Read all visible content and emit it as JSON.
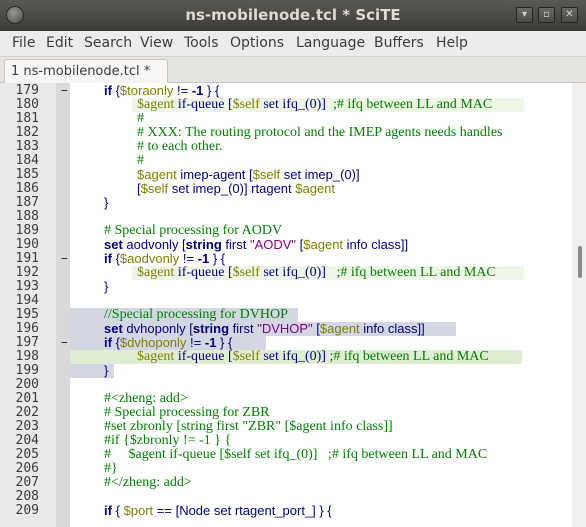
{
  "window": {
    "title": "ns-mobilenode.tcl * SciTE"
  },
  "window_buttons": {
    "minimize": "▾",
    "maximize": "▫",
    "close": "✕"
  },
  "menu": [
    "File",
    "Edit",
    "Search",
    "View",
    "Tools",
    "Options",
    "Language",
    "Buffers",
    "Help"
  ],
  "tab": {
    "label": "1 ns-mobilenode.tcl *"
  },
  "lines": [
    {
      "n": "179",
      "fold": "−",
      "hl": "",
      "tokens": [
        [
          "kw",
          "if"
        ],
        [
          "plain",
          " {"
        ],
        [
          "var",
          "$toraonly"
        ],
        [
          "plain",
          " != "
        ],
        [
          "kw",
          "-1"
        ],
        [
          "plain",
          " } {"
        ]
      ]
    },
    {
      "n": "180",
      "fold": "",
      "hl": "pale",
      "tokens": [
        [
          "var",
          "$agent"
        ],
        [
          "txt",
          " if-queue ["
        ],
        [
          "var",
          "$self"
        ],
        [
          "txt",
          " set ifq_(0)]  "
        ],
        [
          "cmt",
          ";# ifq between LL and MAC"
        ]
      ]
    },
    {
      "n": "181",
      "fold": "",
      "hl": "",
      "tokens": [
        [
          "cmt",
          "#"
        ]
      ]
    },
    {
      "n": "182",
      "fold": "",
      "hl": "",
      "tokens": [
        [
          "cmt",
          "# XXX: The routing protocol and the IMEP agents needs handles"
        ]
      ]
    },
    {
      "n": "183",
      "fold": "",
      "hl": "",
      "tokens": [
        [
          "cmt",
          "# to each other."
        ]
      ]
    },
    {
      "n": "184",
      "fold": "",
      "hl": "",
      "tokens": [
        [
          "cmt",
          "#"
        ]
      ]
    },
    {
      "n": "185",
      "fold": "",
      "hl": "",
      "tokens": [
        [
          "var",
          "$agent"
        ],
        [
          "txt",
          " imep-agent ["
        ],
        [
          "var",
          "$self"
        ],
        [
          "txt",
          " set imep_(0)]"
        ]
      ]
    },
    {
      "n": "186",
      "fold": "",
      "hl": "",
      "tokens": [
        [
          "txt",
          "["
        ],
        [
          "var",
          "$self"
        ],
        [
          "txt",
          " set imep_(0)] rtagent "
        ],
        [
          "var",
          "$agent"
        ]
      ]
    },
    {
      "n": "187",
      "fold": "",
      "hl": "",
      "tokens": [
        [
          "plain",
          "}"
        ]
      ]
    },
    {
      "n": "188",
      "fold": "",
      "hl": "",
      "tokens": []
    },
    {
      "n": "189",
      "fold": "",
      "hl": "",
      "tokens": [
        [
          "cmt",
          "# Special processing for AODV"
        ]
      ]
    },
    {
      "n": "190",
      "fold": "",
      "hl": "",
      "tokens": [
        [
          "kw",
          "set"
        ],
        [
          "txt",
          " aodvonly ["
        ],
        [
          "kw",
          "string"
        ],
        [
          "txt",
          " first "
        ],
        [
          "str",
          "\"AODV\""
        ],
        [
          "txt",
          " ["
        ],
        [
          "var",
          "$agent"
        ],
        [
          "txt",
          " info class]]"
        ]
      ]
    },
    {
      "n": "191",
      "fold": "−",
      "hl": "",
      "tokens": [
        [
          "kw",
          "if"
        ],
        [
          "plain",
          " {"
        ],
        [
          "var",
          "$aodvonly"
        ],
        [
          "plain",
          " != "
        ],
        [
          "kw",
          "-1"
        ],
        [
          "plain",
          " } {"
        ]
      ]
    },
    {
      "n": "192",
      "fold": "",
      "hl": "pale",
      "tokens": [
        [
          "var",
          "$agent"
        ],
        [
          "txt",
          " if-queue ["
        ],
        [
          "var",
          "$self"
        ],
        [
          "txt",
          " set ifq_(0)]   "
        ],
        [
          "cmt",
          ";# ifq between LL and MAC"
        ]
      ]
    },
    {
      "n": "193",
      "fold": "",
      "hl": "",
      "tokens": [
        [
          "plain",
          "}"
        ]
      ]
    },
    {
      "n": "194",
      "fold": "",
      "hl": "",
      "tokens": []
    },
    {
      "n": "195",
      "fold": "",
      "hl": "sel",
      "tokens": [
        [
          "cmt",
          "//Special processing for DVHOP"
        ]
      ]
    },
    {
      "n": "196",
      "fold": "",
      "hl": "sel",
      "tokens": [
        [
          "kw",
          "set"
        ],
        [
          "txt",
          " dvhoponly ["
        ],
        [
          "kw",
          "string"
        ],
        [
          "txt",
          " first "
        ],
        [
          "str",
          "\"DVHOP\""
        ],
        [
          "txt",
          " ["
        ],
        [
          "var",
          "$agent"
        ],
        [
          "txt",
          " info class]]"
        ]
      ]
    },
    {
      "n": "197",
      "fold": "−",
      "hl": "sel",
      "tokens": [
        [
          "kw",
          "if"
        ],
        [
          "plain",
          " {"
        ],
        [
          "var",
          "$dvhoponly"
        ],
        [
          "plain",
          " != "
        ],
        [
          "kw",
          "-1"
        ],
        [
          "plain",
          " } {"
        ]
      ]
    },
    {
      "n": "198",
      "fold": "",
      "hl": "green",
      "tokens": [
        [
          "var",
          "$agent"
        ],
        [
          "txt",
          " if-queue ["
        ],
        [
          "var",
          "$self"
        ],
        [
          "txt",
          " set ifq_(0)] "
        ],
        [
          "cmt",
          ";# ifq between LL and MAC"
        ]
      ]
    },
    {
      "n": "199",
      "fold": "",
      "hl": "sel",
      "tokens": [
        [
          "plain",
          "}"
        ]
      ]
    },
    {
      "n": "200",
      "fold": "",
      "hl": "",
      "tokens": []
    },
    {
      "n": "201",
      "fold": "",
      "hl": "",
      "tokens": [
        [
          "cmt",
          "#<zheng: add>"
        ]
      ]
    },
    {
      "n": "202",
      "fold": "",
      "hl": "",
      "tokens": [
        [
          "cmt",
          "# Special processing for ZBR"
        ]
      ]
    },
    {
      "n": "203",
      "fold": "",
      "hl": "",
      "tokens": [
        [
          "cmt",
          "#set zbronly [string first \"ZBR\" [$agent info class]]"
        ]
      ]
    },
    {
      "n": "204",
      "fold": "",
      "hl": "",
      "tokens": [
        [
          "cmt",
          "#if {$zbronly != -1 } {"
        ]
      ]
    },
    {
      "n": "205",
      "fold": "",
      "hl": "",
      "tokens": [
        [
          "cmt",
          "#     $agent if-queue [$self set ifq_(0)]   ;# ifq between LL and MAC"
        ]
      ]
    },
    {
      "n": "206",
      "fold": "",
      "hl": "",
      "tokens": [
        [
          "cmt",
          "#}"
        ]
      ]
    },
    {
      "n": "207",
      "fold": "",
      "hl": "",
      "tokens": [
        [
          "cmt",
          "#</zheng: add>"
        ]
      ]
    },
    {
      "n": "208",
      "fold": "",
      "hl": "",
      "tokens": []
    },
    {
      "n": "209",
      "fold": "",
      "hl": "",
      "tokens": [
        [
          "kw",
          "if"
        ],
        [
          "plain",
          " { "
        ],
        [
          "var",
          "$port"
        ],
        [
          "plain",
          " == [Node set rtagent_port_] } {"
        ]
      ]
    }
  ]
}
